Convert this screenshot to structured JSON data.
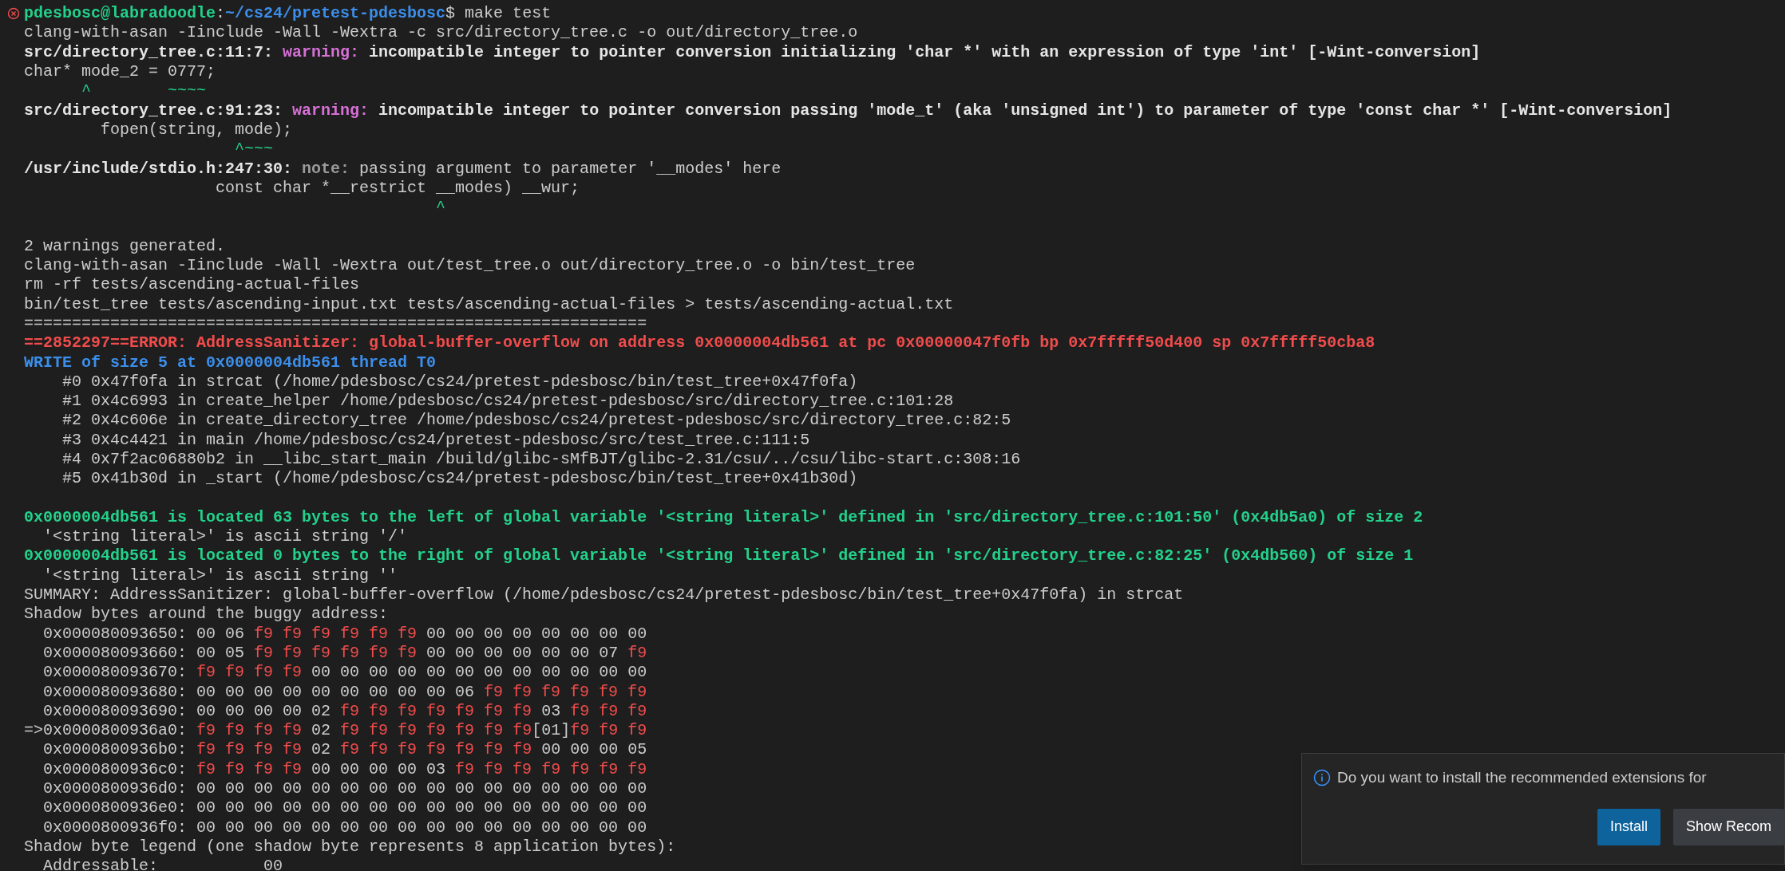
{
  "terminal": {
    "lines": [
      {
        "kind": "command",
        "segments": [
          {
            "kind": "prompt_user",
            "text": "pdesbosc@labradoodle"
          },
          {
            "kind": "plain",
            "text": ":"
          },
          {
            "kind": "prompt_path",
            "text": "~/cs24/pretest-pdesbosc"
          },
          {
            "kind": "plain",
            "text": "$ make test"
          }
        ]
      },
      {
        "kind": "output",
        "segments": [
          {
            "kind": "plain",
            "text": "clang-with-asan -Iinclude -Wall -Wextra -c src/directory_tree.c -o out/directory_tree.o"
          }
        ]
      },
      {
        "kind": "output",
        "segments": [
          {
            "kind": "bold",
            "text": "src/directory_tree.c:11:7: "
          },
          {
            "kind": "warning",
            "text": "warning: "
          },
          {
            "kind": "bold",
            "text": "incompatible integer to pointer conversion initializing 'char *' with an expression of type 'int' [-Wint-conversion]"
          }
        ]
      },
      {
        "kind": "output",
        "segments": [
          {
            "kind": "plain",
            "text": "char* mode_2 = 0777;"
          }
        ]
      },
      {
        "kind": "output",
        "segments": [
          {
            "kind": "caret",
            "text": "      ^        ~~~~"
          }
        ]
      },
      {
        "kind": "output",
        "segments": [
          {
            "kind": "bold",
            "text": "src/directory_tree.c:91:23: "
          },
          {
            "kind": "warning",
            "text": "warning: "
          },
          {
            "kind": "bold",
            "text": "incompatible integer to pointer conversion passing 'mode_t' (aka 'unsigned int') to parameter of type 'const char *' [-Wint-conversion]"
          }
        ]
      },
      {
        "kind": "output",
        "segments": [
          {
            "kind": "plain",
            "text": "        fopen(string, mode);"
          }
        ]
      },
      {
        "kind": "output",
        "segments": [
          {
            "kind": "caret",
            "text": "                      ^~~~"
          }
        ]
      },
      {
        "kind": "output",
        "segments": [
          {
            "kind": "bold",
            "text": "/usr/include/stdio.h:247:30: "
          },
          {
            "kind": "note",
            "text": "note: "
          },
          {
            "kind": "plain",
            "text": "passing argument to parameter '__modes' here"
          }
        ]
      },
      {
        "kind": "output",
        "segments": [
          {
            "kind": "plain",
            "text": "                    const char *__restrict __modes) __wur;"
          }
        ]
      },
      {
        "kind": "output",
        "segments": [
          {
            "kind": "caret",
            "text": "                                           ^"
          }
        ]
      },
      {
        "kind": "blank"
      },
      {
        "kind": "output",
        "segments": [
          {
            "kind": "plain",
            "text": "2 warnings generated."
          }
        ]
      },
      {
        "kind": "output",
        "segments": [
          {
            "kind": "plain",
            "text": "clang-with-asan -Iinclude -Wall -Wextra out/test_tree.o out/directory_tree.o -o bin/test_tree"
          }
        ]
      },
      {
        "kind": "output",
        "segments": [
          {
            "kind": "plain",
            "text": "rm -rf tests/ascending-actual-files"
          }
        ]
      },
      {
        "kind": "output",
        "segments": [
          {
            "kind": "plain",
            "text": "bin/test_tree tests/ascending-input.txt tests/ascending-actual-files > tests/ascending-actual.txt"
          }
        ]
      },
      {
        "kind": "output",
        "segments": [
          {
            "kind": "plain",
            "text": "================================================================="
          }
        ]
      },
      {
        "kind": "output",
        "segments": [
          {
            "kind": "error",
            "text": "==2852297==ERROR: AddressSanitizer: global-buffer-overflow on address 0x0000004db561 at pc 0x00000047f0fb bp 0x7fffff50d400 sp 0x7fffff50cba8"
          }
        ]
      },
      {
        "kind": "output",
        "segments": [
          {
            "kind": "write",
            "text": "WRITE of size 5 at 0x0000004db561 thread T0"
          }
        ]
      },
      {
        "kind": "output",
        "segments": [
          {
            "kind": "plain",
            "text": "    #0 0x47f0fa in strcat (/home/pdesbosc/cs24/pretest-pdesbosc/bin/test_tree+0x47f0fa)"
          }
        ]
      },
      {
        "kind": "output",
        "segments": [
          {
            "kind": "plain",
            "text": "    #1 0x4c6993 in create_helper /home/pdesbosc/cs24/pretest-pdesbosc/src/directory_tree.c:101:28"
          }
        ]
      },
      {
        "kind": "output",
        "segments": [
          {
            "kind": "plain",
            "text": "    #2 0x4c606e in create_directory_tree /home/pdesbosc/cs24/pretest-pdesbosc/src/directory_tree.c:82:5"
          }
        ]
      },
      {
        "kind": "output",
        "segments": [
          {
            "kind": "plain",
            "text": "    #3 0x4c4421 in main /home/pdesbosc/cs24/pretest-pdesbosc/src/test_tree.c:111:5"
          }
        ]
      },
      {
        "kind": "output",
        "segments": [
          {
            "kind": "plain",
            "text": "    #4 0x7f2ac06880b2 in __libc_start_main /build/glibc-sMfBJT/glibc-2.31/csu/../csu/libc-start.c:308:16"
          }
        ]
      },
      {
        "kind": "output",
        "segments": [
          {
            "kind": "plain",
            "text": "    #5 0x41b30d in _start (/home/pdesbosc/cs24/pretest-pdesbosc/bin/test_tree+0x41b30d)"
          }
        ]
      },
      {
        "kind": "blank"
      },
      {
        "kind": "output",
        "segments": [
          {
            "kind": "located",
            "text": "0x0000004db561 is located 63 bytes to the left of global variable '<string literal>' defined in 'src/directory_tree.c:101:50' (0x4db5a0) of size 2"
          }
        ]
      },
      {
        "kind": "output",
        "segments": [
          {
            "kind": "plain",
            "text": "  '<string literal>' is ascii string '/'"
          }
        ]
      },
      {
        "kind": "output",
        "segments": [
          {
            "kind": "located",
            "text": "0x0000004db561 is located 0 bytes to the right of global variable '<string literal>' defined in 'src/directory_tree.c:82:25' (0x4db560) of size 1"
          }
        ]
      },
      {
        "kind": "output",
        "segments": [
          {
            "kind": "plain",
            "text": "  '<string literal>' is ascii string ''"
          }
        ]
      },
      {
        "kind": "output",
        "segments": [
          {
            "kind": "plain",
            "text": "SUMMARY: AddressSanitizer: global-buffer-overflow (/home/pdesbosc/cs24/pretest-pdesbosc/bin/test_tree+0x47f0fa) in strcat"
          }
        ]
      },
      {
        "kind": "output",
        "segments": [
          {
            "kind": "plain",
            "text": "Shadow bytes around the buggy address:"
          }
        ]
      },
      {
        "kind": "output",
        "segments": [
          {
            "kind": "plain",
            "text": "  0x000080093650: 00 06 "
          },
          {
            "kind": "bad_byte",
            "text": "f9 f9 f9 f9 f9 f9"
          },
          {
            "kind": "plain",
            "text": " 00 00 00 00 00 00 00 00"
          }
        ]
      },
      {
        "kind": "output",
        "segments": [
          {
            "kind": "plain",
            "text": "  0x000080093660: 00 05 "
          },
          {
            "kind": "bad_byte",
            "text": "f9 f9 f9 f9 f9 f9"
          },
          {
            "kind": "plain",
            "text": " 00 00 00 00 00 00 07 "
          },
          {
            "kind": "bad_byte",
            "text": "f9"
          }
        ]
      },
      {
        "kind": "output",
        "segments": [
          {
            "kind": "plain",
            "text": "  0x000080093670: "
          },
          {
            "kind": "bad_byte",
            "text": "f9 f9 f9 f9"
          },
          {
            "kind": "plain",
            "text": " 00 00 00 00 00 00 00 00 00 00 00 00"
          }
        ]
      },
      {
        "kind": "output",
        "segments": [
          {
            "kind": "plain",
            "text": "  0x000080093680: 00 00 00 00 00 00 00 00 00 06 "
          },
          {
            "kind": "bad_byte",
            "text": "f9 f9 f9 f9 f9 f9"
          }
        ]
      },
      {
        "kind": "output",
        "segments": [
          {
            "kind": "plain",
            "text": "  0x000080093690: 00 00 00 00 02 "
          },
          {
            "kind": "bad_byte",
            "text": "f9 f9 f9 f9 f9 f9 f9"
          },
          {
            "kind": "plain",
            "text": " 03 "
          },
          {
            "kind": "bad_byte",
            "text": "f9 f9 f9"
          }
        ]
      },
      {
        "kind": "output",
        "segments": [
          {
            "kind": "plain",
            "text": "=>0x0000800936a0: "
          },
          {
            "kind": "bad_byte",
            "text": "f9 f9 f9 f9"
          },
          {
            "kind": "plain",
            "text": " 02 "
          },
          {
            "kind": "bad_byte",
            "text": "f9 f9 f9 f9 f9 f9 f9"
          },
          {
            "kind": "plain",
            "text": "[01]"
          },
          {
            "kind": "bad_byte",
            "text": "f9 f9 f9"
          }
        ]
      },
      {
        "kind": "output",
        "segments": [
          {
            "kind": "plain",
            "text": "  0x0000800936b0: "
          },
          {
            "kind": "bad_byte",
            "text": "f9 f9 f9 f9"
          },
          {
            "kind": "plain",
            "text": " 02 "
          },
          {
            "kind": "bad_byte",
            "text": "f9 f9 f9 f9 f9 f9 f9"
          },
          {
            "kind": "plain",
            "text": " 00 00 00 05"
          }
        ]
      },
      {
        "kind": "output",
        "segments": [
          {
            "kind": "plain",
            "text": "  0x0000800936c0: "
          },
          {
            "kind": "bad_byte",
            "text": "f9 f9 f9 f9"
          },
          {
            "kind": "plain",
            "text": " 00 00 00 00 03 "
          },
          {
            "kind": "bad_byte",
            "text": "f9 f9 f9 f9 f9 f9 f9"
          }
        ]
      },
      {
        "kind": "output",
        "segments": [
          {
            "kind": "plain",
            "text": "  0x0000800936d0: 00 00 00 00 00 00 00 00 00 00 00 00 00 00 00 00"
          }
        ]
      },
      {
        "kind": "output",
        "segments": [
          {
            "kind": "plain",
            "text": "  0x0000800936e0: 00 00 00 00 00 00 00 00 00 00 00 00 00 00 00 00"
          }
        ]
      },
      {
        "kind": "output",
        "segments": [
          {
            "kind": "plain",
            "text": "  0x0000800936f0: 00 00 00 00 00 00 00 00 00 00 00 00 00 00 00 00"
          }
        ]
      },
      {
        "kind": "output",
        "segments": [
          {
            "kind": "plain",
            "text": "Shadow byte legend (one shadow byte represents 8 application bytes):"
          }
        ]
      },
      {
        "kind": "output",
        "segments": [
          {
            "kind": "plain",
            "text": "  Addressable:           00"
          }
        ]
      }
    ]
  },
  "notification": {
    "message": "Do you want to install the recommended extensions for",
    "buttons": [
      {
        "kind": "primary",
        "label": "Install"
      },
      {
        "kind": "secondary",
        "label": "Show Recom"
      }
    ]
  }
}
